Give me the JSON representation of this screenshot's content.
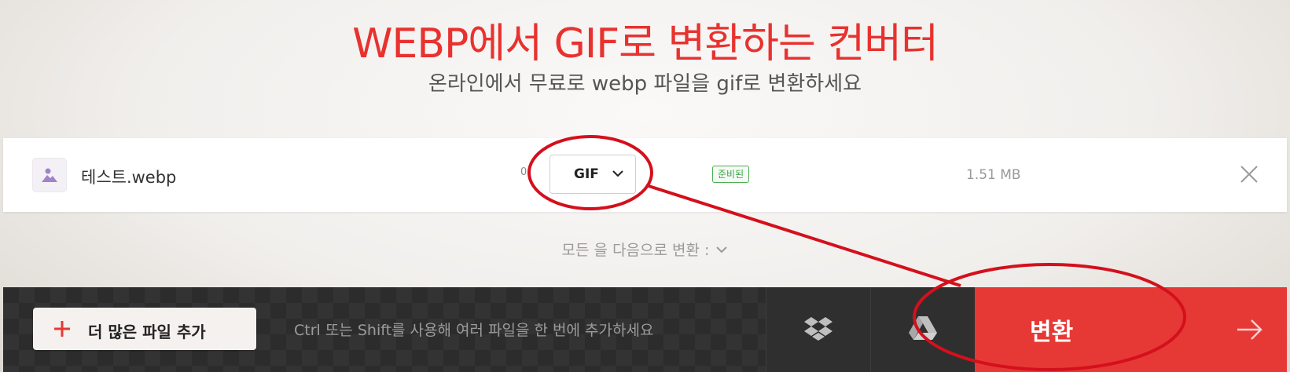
{
  "header": {
    "title": "WEBP에서 GIF로 변환하는 컨버터",
    "subtitle": "온라인에서 무료로 webp 파일을 gif로 변환하세요"
  },
  "file": {
    "name": "테스트.webp",
    "extra_char": "0",
    "format": "GIF",
    "status": "준비된",
    "size": "1.51 MB"
  },
  "convert_all": {
    "label": "모든 을 다음으로 변환 :"
  },
  "bottom_bar": {
    "add_files_label": "더 많은 파일 추가",
    "hint": "Ctrl 또는 Shift를 사용해 여러 파일을 한 번에 추가하세요",
    "convert_label": "변환"
  },
  "icons": [
    "image-icon",
    "chevron-down-icon",
    "close-icon",
    "plus-icon",
    "dropbox-icon",
    "google-drive-icon",
    "arrow-right-icon"
  ],
  "colors": {
    "accent": "#e8322f",
    "convert_button": "#e63935",
    "status_green": "#3aa246",
    "annotation": "#d4101c"
  }
}
